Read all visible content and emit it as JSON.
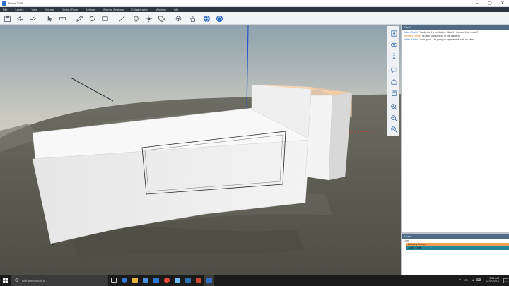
{
  "window": {
    "title": "Fuzor 2018",
    "minimize_icon": "minimize-icon",
    "maximize_icon": "maximize-icon",
    "close_icon": "close-icon"
  },
  "menu": [
    "File",
    "Layers",
    "View",
    "Create",
    "Design Tools",
    "Settings",
    "Energy Analysis",
    "Collaboration",
    "Window",
    "Info"
  ],
  "toolbar": {
    "icons": [
      "save-icon",
      "undo-icon",
      "redo-icon",
      "select-cursor-icon",
      "measure-icon",
      "pencil-icon",
      "rotate-icon",
      "rectangle-icon",
      "line-icon",
      "location-pin-icon",
      "sun-icon",
      "tag-icon",
      "settings-gear-icon",
      "hand-pointer-icon",
      "globe-icon",
      "headset-icon"
    ]
  },
  "side_tools": {
    "icons": [
      "zoom-extents-icon",
      "orbit-icon",
      "walk-icon",
      "chat-bubble-icon",
      "home-view-icon",
      "pan-hand-icon",
      "zoom-in-icon",
      "zoom-out-icon",
      "fit-view-icon"
    ]
  },
  "chat": {
    "header": "Chat",
    "messages": [
      {
        "name": "Julien Smith",
        "text": "Thanks for the invitation. Mind if I inspect that model?",
        "name_color": "#2a6bc7"
      },
      {
        "name": "Bethany Lemon",
        "text": "I'll give you control of the camera.",
        "name_color": "#d9822b"
      },
      {
        "name": "Julien Smith",
        "text": "Looks good. I'm going to experiment with an idea.",
        "name_color": "#2a6bc7"
      }
    ]
  },
  "users": {
    "header": "Users",
    "label": "User",
    "list": [
      {
        "name": "Bethany Lemon",
        "color": "#f0a052"
      },
      {
        "name": "Julien Smith",
        "color": "#27889a"
      }
    ]
  },
  "taskbar": {
    "search_placeholder": "Ask me anything",
    "apps": [
      {
        "icon": "task-view-icon",
        "color": "#cfcfcf"
      },
      {
        "icon": "edge-icon",
        "color": "#3277d8"
      },
      {
        "icon": "file-explorer-icon",
        "color": "#e8b33a"
      },
      {
        "icon": "store-icon",
        "color": "#4a8fe0"
      },
      {
        "icon": "mail-icon",
        "color": "#2b79d0"
      },
      {
        "icon": "chrome-icon",
        "color": "#e84a3a"
      },
      {
        "icon": "photos-icon",
        "color": "#6fb9ff"
      },
      {
        "icon": "revit-icon",
        "color": "#2e6fb0"
      },
      {
        "icon": "sketchup-icon",
        "color": "#c9482f"
      },
      {
        "icon": "fuzor-icon",
        "color": "#2f6fc4"
      }
    ],
    "time": "9:24 AM",
    "date": "10/22/2018",
    "tray_icons": [
      "chevron-up-icon",
      "network-icon",
      "volume-icon",
      "keyboard-icon"
    ]
  },
  "colors": {
    "menubar": "#2e3640",
    "panel_header": "#506b86",
    "accent": "#2f6fc4"
  }
}
